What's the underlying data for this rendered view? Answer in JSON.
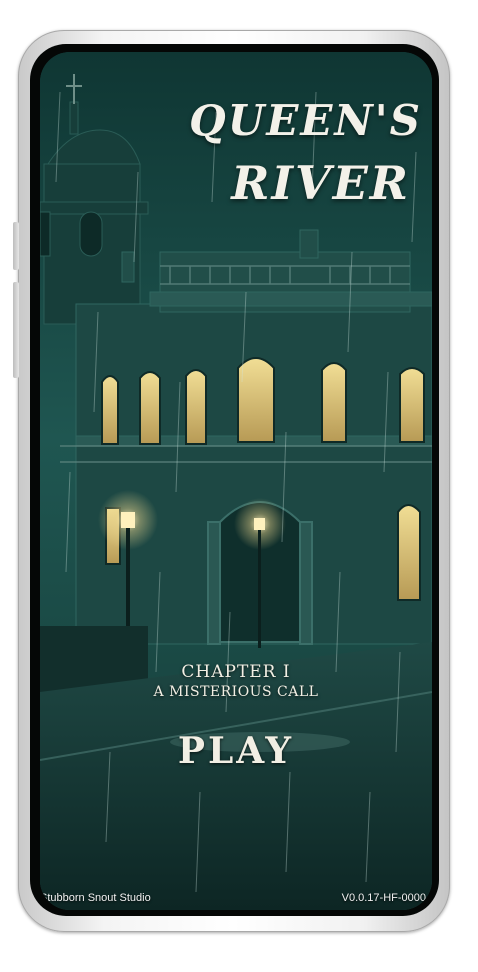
{
  "game": {
    "title_line1": "QUEEN'S",
    "title_line2": "RIVER",
    "chapter_label": "CHAPTER I",
    "chapter_subtitle": "A MISTERIOUS CALL",
    "play_label": "PLAY",
    "studio": "Stubborn Snout Studio",
    "version": "V0.0.17-HF-0000"
  },
  "colors": {
    "sky": "#123c39",
    "title_text": "#f3f1e9",
    "window_glow": "#e6cf86"
  }
}
